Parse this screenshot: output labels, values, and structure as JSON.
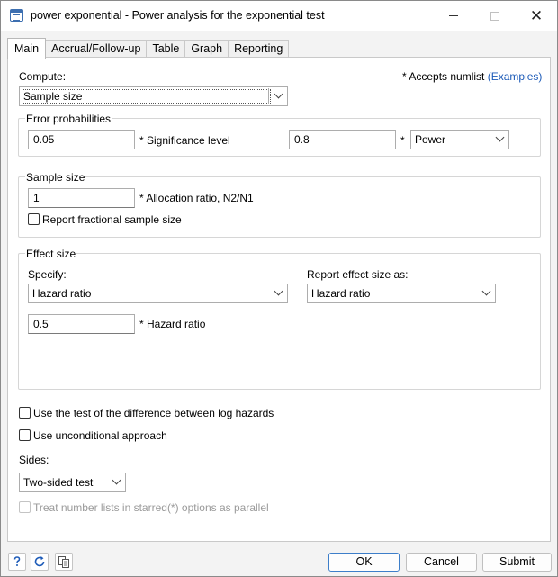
{
  "window": {
    "title": "power exponential - Power analysis for the exponential test"
  },
  "tabs": [
    {
      "label": "Main"
    },
    {
      "label": "Accrual/Follow-up"
    },
    {
      "label": "Table"
    },
    {
      "label": "Graph"
    },
    {
      "label": "Reporting"
    }
  ],
  "main": {
    "compute_label": "Compute:",
    "compute_value": "Sample size",
    "numlist_note": "* Accepts numlist",
    "examples_link": "(Examples)",
    "error_prob": {
      "title": "Error probabilities",
      "alpha_value": "0.05",
      "alpha_label": "* Significance level",
      "power_value": "0.8",
      "power_star": "*",
      "power_select": "Power"
    },
    "sample_size": {
      "title": "Sample size",
      "ratio_value": "1",
      "ratio_label": "* Allocation ratio, N2/N1",
      "fractional_label": "Report fractional sample size"
    },
    "effect_size": {
      "title": "Effect size",
      "specify_label": "Specify:",
      "specify_value": "Hazard ratio",
      "report_label": "Report effect size as:",
      "report_value": "Hazard ratio",
      "hr_value": "0.5",
      "hr_label": "* Hazard ratio"
    },
    "log_hazard_label": "Use the test of the difference between log hazards",
    "unconditional_label": "Use unconditional approach",
    "sides_label": "Sides:",
    "sides_value": "Two-sided test",
    "parallel_label": "Treat number lists in starred(*) options as parallel"
  },
  "footer": {
    "ok": "OK",
    "cancel": "Cancel",
    "submit": "Submit"
  },
  "icons": {
    "help": "help-icon",
    "reset": "reset-icon",
    "copy": "copy-icon"
  }
}
